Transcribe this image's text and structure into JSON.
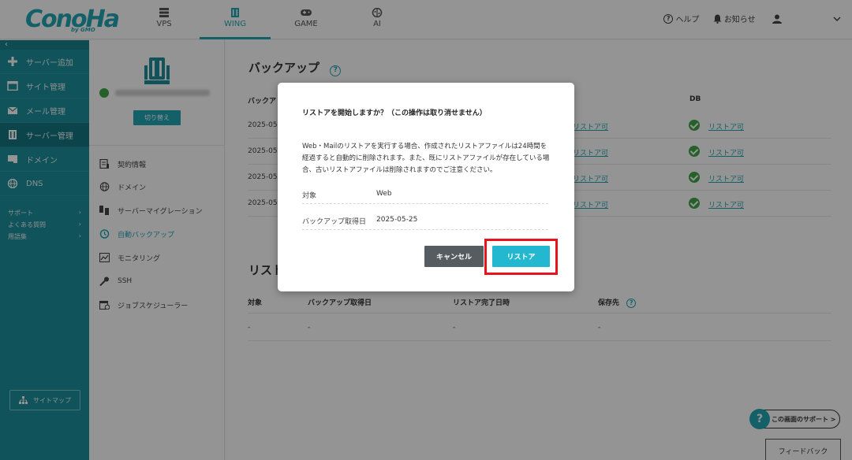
{
  "header": {
    "logo_text": "ConoHa",
    "logo_sub": "by GMO",
    "tabs": [
      {
        "label": "VPS",
        "icon": "server-icon"
      },
      {
        "label": "WING",
        "icon": "wing-server-icon"
      },
      {
        "label": "GAME",
        "icon": "gamepad-icon"
      },
      {
        "label": "AI",
        "icon": "ai-brain-icon"
      }
    ],
    "active_tab": "WING",
    "help_label": "ヘルプ",
    "notice_label": "お知らせ"
  },
  "sidebar": {
    "items": [
      {
        "label": "サーバー追加",
        "icon": "plus-icon"
      },
      {
        "label": "サイト管理",
        "icon": "browser-icon"
      },
      {
        "label": "メール管理",
        "icon": "mail-icon"
      },
      {
        "label": "サーバー管理",
        "icon": "server-icon"
      },
      {
        "label": "ドメイン",
        "icon": "domain-icon"
      },
      {
        "label": "DNS",
        "icon": "globe-icon"
      }
    ],
    "active": "サーバー管理",
    "sub_links": [
      "サポート",
      "よくある質問",
      "用語集"
    ],
    "sitemap_label": "サイトマップ"
  },
  "panel": {
    "switch_label": "切り替え",
    "menu": [
      {
        "label": "契約情報",
        "icon": "contract-icon"
      },
      {
        "label": "ドメイン",
        "icon": "globe-icon"
      },
      {
        "label": "サーバーマイグレーション",
        "icon": "migration-icon"
      },
      {
        "label": "自動バックアップ",
        "icon": "backup-icon"
      },
      {
        "label": "モニタリング",
        "icon": "chart-icon"
      },
      {
        "label": "SSH",
        "icon": "key-icon"
      },
      {
        "label": "ジョブスケジューラー",
        "icon": "calendar-icon"
      }
    ],
    "active": "自動バックアップ"
  },
  "main": {
    "backup_title": "バックアップ",
    "backup_header_left": "バックア",
    "db_header": "DB",
    "rows": [
      {
        "date": "2025-05",
        "web": "リストア可",
        "db": "リストア可"
      },
      {
        "date": "2025-05",
        "web": "リストア可",
        "db": "リストア可"
      },
      {
        "date": "2025-05",
        "web": "リストア可",
        "db": "リストア可"
      },
      {
        "date": "2025-05",
        "web": "リストア可",
        "db": "リストア可"
      }
    ],
    "restore_title": "リスト",
    "restore_headers": [
      "対象",
      "バックアップ取得日",
      "リストア完了日時",
      "保存先"
    ],
    "restore_values": [
      "-",
      "-",
      "-",
      "-"
    ],
    "support_label": "この画面のサポート >",
    "feedback_label": "フィードバック"
  },
  "modal": {
    "title": "リストアを開始しますか？（この操作は取り消せません）",
    "body": "Web・Mailのリストアを実行する場合、作成されたリストアファイルは24時間を経過すると自動的に削除されます。また、既にリストアファイルが存在している場合、古いリストアファイルは削除されますのでご注意ください。",
    "target_label": "対象",
    "target_value": "Web",
    "date_label": "バックアップ取得日",
    "date_value": "2025-05-25",
    "cancel_label": "キャンセル",
    "restore_label": "リストア",
    "highlight_color": "#e8141c"
  }
}
